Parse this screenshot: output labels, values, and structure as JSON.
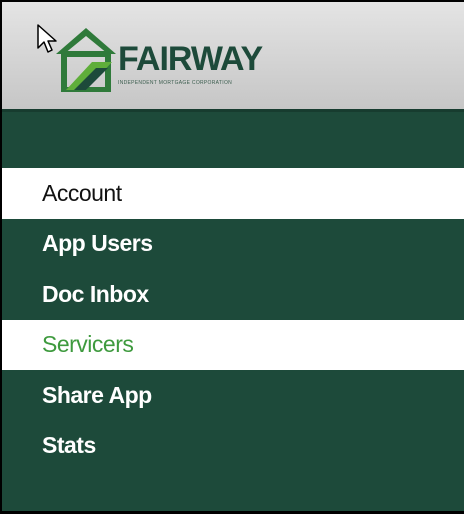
{
  "header": {
    "logo_text": "FAIRWAY",
    "logo_tagline": "INDEPENDENT MORTGAGE CORPORATION"
  },
  "menu": {
    "items": [
      {
        "label": "Account"
      },
      {
        "label": "App Users"
      },
      {
        "label": "Doc Inbox"
      },
      {
        "label": "Servicers"
      },
      {
        "label": "Share App"
      },
      {
        "label": "Stats"
      }
    ]
  },
  "colors": {
    "sidebar_bg": "#1d4a3a",
    "accent_green": "#3e9a3e",
    "header_bg": "#d6d6d6"
  },
  "icons": {
    "logo": "fairway-house-logo-icon",
    "cursor": "mouse-pointer-icon"
  }
}
